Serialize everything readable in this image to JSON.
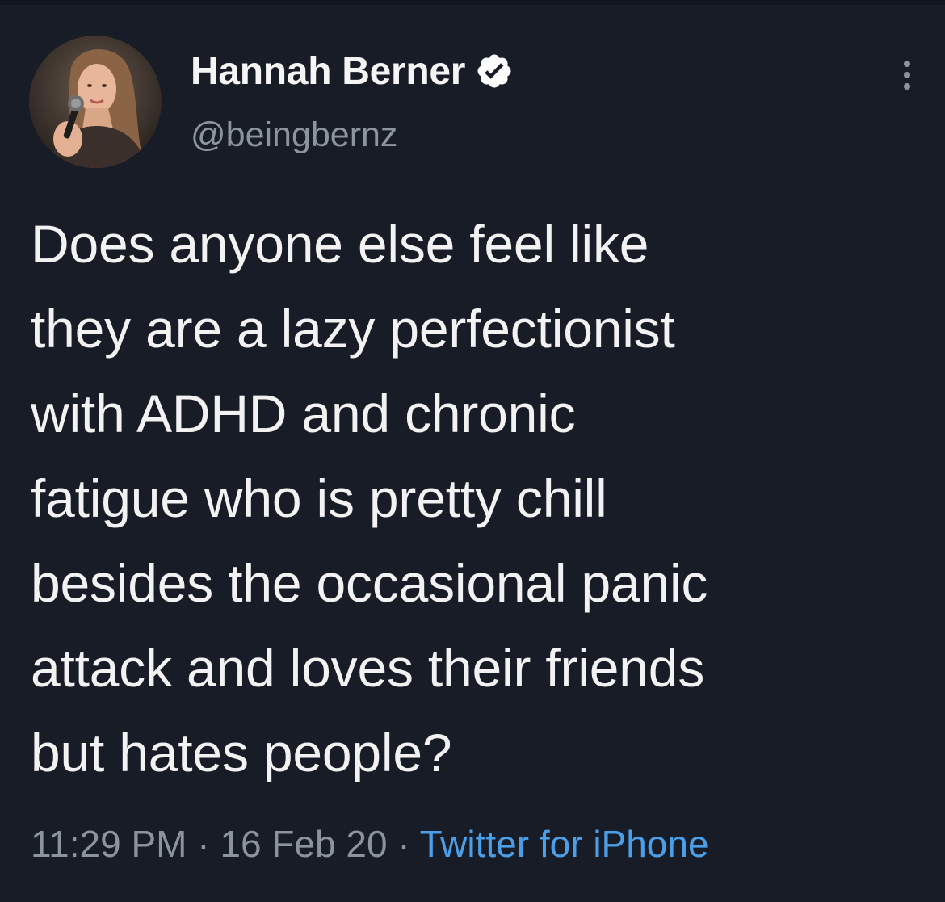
{
  "author": {
    "display_name": "Hannah Berner",
    "handle": "@beingbernz",
    "verified": true,
    "avatar_icon": "profile-photo-microphone"
  },
  "tweet": {
    "lines": [
      "Does anyone else feel like",
      "they are a lazy perfectionist",
      "with ADHD and chronic",
      "fatigue who is pretty chill",
      "besides the occasional panic",
      "attack and loves their friends",
      "but hates people?"
    ]
  },
  "meta": {
    "time": "11:29 PM",
    "separator": " · ",
    "date": "16 Feb 20",
    "source": "Twitter for iPhone"
  },
  "icons": {
    "verified": "verified-badge-icon",
    "more": "more-options-icon"
  },
  "colors": {
    "background": "#171c26",
    "text": "#f2f2f2",
    "secondary": "#8b939c",
    "link": "#4b9ee8"
  }
}
